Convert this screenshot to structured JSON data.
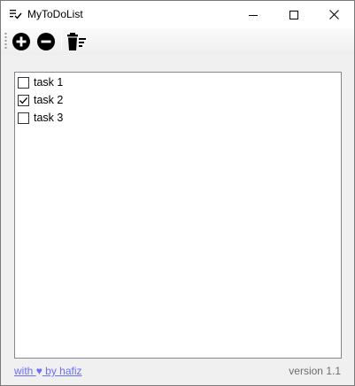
{
  "window": {
    "title": "MyToDoList",
    "icon": "checklist-icon",
    "controls": {
      "minimize": "minimize-icon",
      "maximize": "maximize-icon",
      "close": "close-icon"
    }
  },
  "toolbar": {
    "add": {
      "icon": "plus-circle-icon"
    },
    "remove": {
      "icon": "minus-circle-icon"
    },
    "clear": {
      "icon": "trash-list-icon"
    }
  },
  "tasks": [
    {
      "label": "task 1",
      "checked": false
    },
    {
      "label": "task 2",
      "checked": true
    },
    {
      "label": "task 3",
      "checked": false
    }
  ],
  "footer": {
    "link_prefix": "with",
    "heart": "♥",
    "link_suffix": "by hafiz",
    "version": "version 1.1"
  },
  "colors": {
    "link": "#6a6ff5",
    "version": "#6d6d6d",
    "list_border": "#828790"
  }
}
